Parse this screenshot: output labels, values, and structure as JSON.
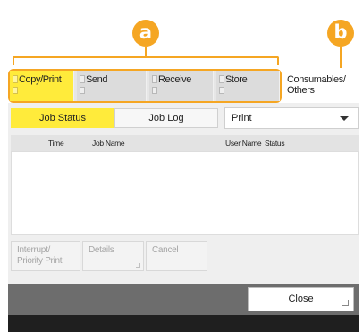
{
  "callouts": {
    "a": "a",
    "b": "b"
  },
  "colors": {
    "callout": "#f5a623",
    "active_tab": "#ffeb3b",
    "footer": "#6d6d6d"
  },
  "tabs": [
    {
      "label": "Copy/Print",
      "active": true
    },
    {
      "label": "Send",
      "active": false
    },
    {
      "label": "Receive",
      "active": false
    },
    {
      "label": "Store",
      "active": false
    }
  ],
  "consumables_tab": {
    "line1": "Consumables/",
    "line2": "Others"
  },
  "view_toggle": {
    "job_status": "Job Status",
    "job_log": "Job Log",
    "selected": "Job Status"
  },
  "job_type_select": {
    "value": "Print",
    "icon": "chevron-down-icon"
  },
  "table": {
    "columns": [
      "Time",
      "Job Name",
      "User Name",
      "Status"
    ],
    "rows": []
  },
  "actions": {
    "interrupt_line1": "Interrupt/",
    "interrupt_line2": "Priority Print",
    "details": "Details",
    "cancel": "Cancel"
  },
  "footer": {
    "close": "Close"
  }
}
